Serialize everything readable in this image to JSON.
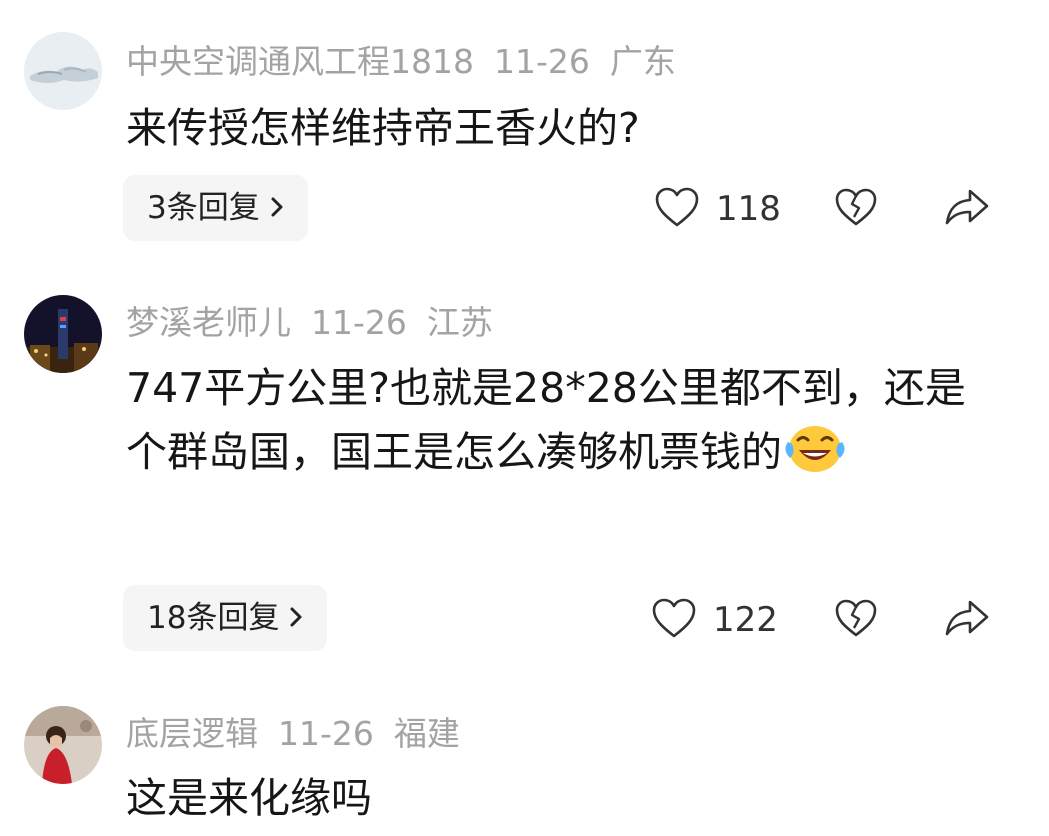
{
  "colors": {
    "meta_text": "#a3a3a3",
    "body_text": "#161616",
    "reply_bg": "#f5f5f5",
    "icon_stroke": "#333333"
  },
  "comments": [
    {
      "username": "中央空调通风工程1818",
      "date": "11-26",
      "location": "广东",
      "text": "来传授怎样维持帝王香火的?",
      "replies_label": "3条回复",
      "likes": "118",
      "avatar_icon": "landscape-avatar"
    },
    {
      "username": "梦溪老师儿",
      "date": "11-26",
      "location": "江苏",
      "text": "747平方公里?也就是28*28公里都不到，还是个群岛国，国王是怎么凑够机票钱的",
      "emoji_icon": "laughing-tears-emoji",
      "replies_label": "18条回复",
      "likes": "122",
      "avatar_icon": "night-city-avatar"
    },
    {
      "username": "底层逻辑",
      "date": "11-26",
      "location": "福建",
      "text": "这是来化缘吗",
      "avatar_icon": "person-avatar"
    }
  ],
  "icons": {
    "like": "heart-outline-icon",
    "dislike": "broken-heart-icon",
    "share": "share-arrow-icon",
    "chevron": "chevron-right-icon"
  }
}
